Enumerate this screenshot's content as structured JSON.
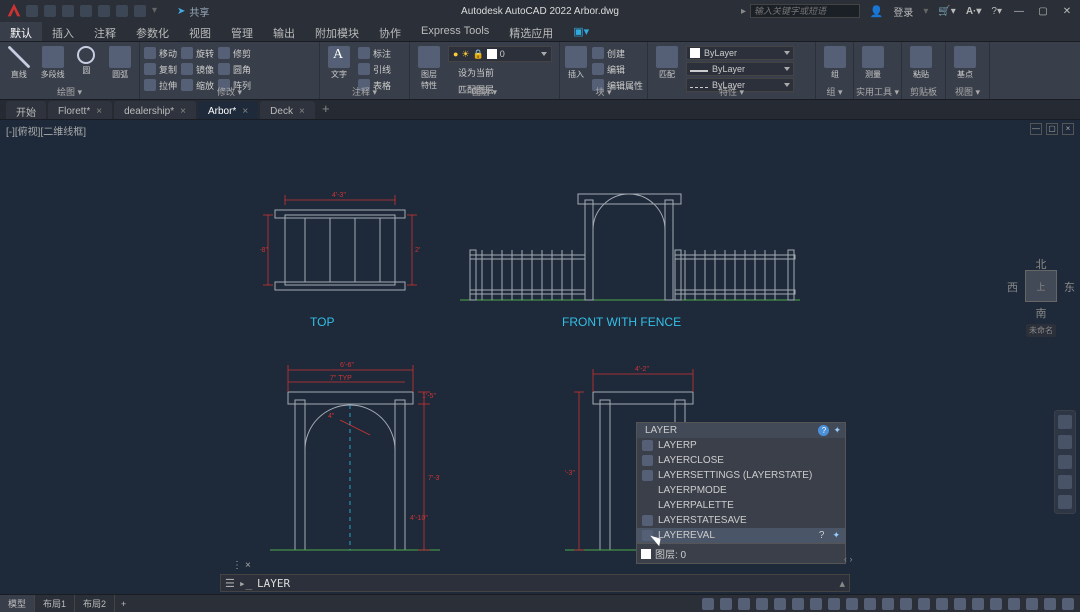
{
  "app": {
    "title": "Autodesk AutoCAD 2022   Arbor.dwg",
    "share": "共享",
    "search_placeholder": "输入关键字或短语",
    "login": "登录",
    "qat_icons": [
      "new",
      "open",
      "save",
      "saveas",
      "plot",
      "undo",
      "redo",
      "share"
    ]
  },
  "menu": {
    "tabs": [
      "默认",
      "插入",
      "注释",
      "参数化",
      "视图",
      "管理",
      "输出",
      "附加模块",
      "协作",
      "Express Tools",
      "精选应用"
    ],
    "active": 0
  },
  "ribbon": {
    "draw": {
      "title": "绘图 ▾",
      "big": [
        "直线",
        "多段线",
        "圆",
        "圆弧"
      ]
    },
    "modify": {
      "title": "修改 ▾",
      "items": [
        "移动",
        "复制",
        "拉伸",
        "旋转",
        "镜像",
        "缩放",
        "修剪",
        "圆角",
        "阵列"
      ]
    },
    "annot": {
      "title": "注释 ▾",
      "big": "文字",
      "items": [
        "标注",
        "引线",
        "表格"
      ]
    },
    "layers": {
      "title": "图层 ▾",
      "big": "图层\n特性",
      "current": "0"
    },
    "block": {
      "title": "块 ▾",
      "big": "插入",
      "items": [
        "创建",
        "编辑",
        "编辑属性"
      ]
    },
    "props": {
      "title": "特性 ▾",
      "big": "匹配",
      "items": [
        "ByLayer",
        "ByLayer",
        "ByLayer"
      ]
    },
    "group": {
      "title": "组 ▾",
      "big": "组"
    },
    "util": {
      "title": "实用工具 ▾",
      "big": "测量"
    },
    "clip": {
      "title": "剪贴板",
      "big": "粘贴"
    },
    "view": {
      "title": "视图 ▾",
      "big": "基点"
    },
    "layerbar_icons": [
      "freeze",
      "lock",
      "color",
      "plot",
      "more"
    ],
    "layerbar_row2": [
      "设为当前",
      "匹配图层"
    ],
    "blockextras": "…"
  },
  "filetabs": {
    "items": [
      {
        "label": "开始",
        "active": false,
        "mod": false,
        "closable": false
      },
      {
        "label": "Florett*",
        "active": false,
        "mod": true,
        "closable": true
      },
      {
        "label": "dealership*",
        "active": false,
        "mod": true,
        "closable": true
      },
      {
        "label": "Arbor*",
        "active": true,
        "mod": true,
        "closable": true
      },
      {
        "label": "Deck",
        "active": false,
        "mod": false,
        "closable": true
      }
    ]
  },
  "canvas": {
    "viewport_label": "[-][俯视][二维线框]",
    "labels": {
      "top": "TOP",
      "front": "FRONT WITH FENCE"
    },
    "dims": {
      "top_w": "4'-3\"",
      "top_h": "2'-8\"",
      "arbor_w": "6'-6\"",
      "arbor_h": "7'-3\"",
      "post": "4\"",
      "header": "1'-5\"",
      "opening": "4'-2\"",
      "arch": "4'-10\""
    }
  },
  "nav": {
    "n": "北",
    "s": "南",
    "e": "东",
    "w": "西",
    "face": "上",
    "unnamed": "未命名"
  },
  "cmdpop": {
    "head": "LAYER",
    "items": [
      "LAYERP",
      "LAYERCLOSE",
      "LAYERSETTINGS  (LAYERSTATE)",
      "LAYERPMODE",
      "LAYERPALETTE",
      "LAYERSTATESAVE",
      "LAYEREVAL"
    ],
    "foot_label": "图层: 0"
  },
  "cmdline": {
    "value": "LAYER",
    "prefix": "▸_"
  },
  "layouts": {
    "items": [
      "模型",
      "布局1",
      "布局2"
    ],
    "active": 0
  }
}
